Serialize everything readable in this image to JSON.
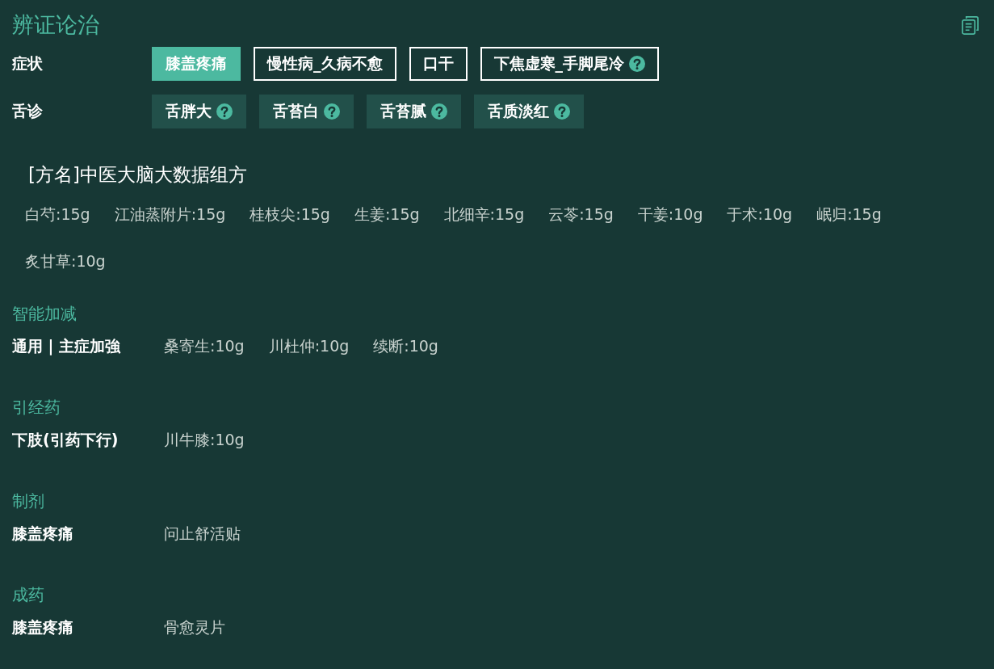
{
  "header": {
    "title": "辨证论治"
  },
  "symptoms": {
    "label": "症状",
    "tags": [
      {
        "text": "膝盖疼痛",
        "selected": true,
        "help": false
      },
      {
        "text": "慢性病_久病不愈",
        "selected": false,
        "help": false
      },
      {
        "text": "口干",
        "selected": false,
        "help": false
      },
      {
        "text": "下焦虚寒_手脚尾冷",
        "selected": false,
        "help": true
      }
    ]
  },
  "tongue": {
    "label": "舌诊",
    "tags": [
      {
        "text": "舌胖大",
        "help": true
      },
      {
        "text": "舌苔白",
        "help": true
      },
      {
        "text": "舌苔腻",
        "help": true
      },
      {
        "text": "舌质淡红",
        "help": true
      }
    ]
  },
  "prescription": {
    "name": "[方名]中医大脑大数据组方",
    "herbs": [
      "白芍:15g",
      "江油蒸附片:15g",
      "桂枝尖:15g",
      "生姜:15g",
      "北细辛:15g",
      "云苓:15g",
      "干姜:10g",
      "于术:10g",
      "岷归:15g",
      "炙甘草:10g"
    ]
  },
  "sections": [
    {
      "heading": "智能加减",
      "rows": [
        {
          "label": "通用 | 主症加強",
          "items": [
            "桑寄生:10g",
            "川杜仲:10g",
            "续断:10g"
          ]
        }
      ]
    },
    {
      "heading": "引经药",
      "rows": [
        {
          "label": "下肢(引药下行)",
          "items": [
            "川牛膝:10g"
          ]
        }
      ]
    },
    {
      "heading": "制剂",
      "rows": [
        {
          "label": "膝盖疼痛",
          "items": [
            "问止舒活贴"
          ]
        }
      ]
    },
    {
      "heading": "成药",
      "rows": [
        {
          "label": "膝盖疼痛",
          "items": [
            "骨愈灵片"
          ]
        }
      ]
    }
  ]
}
